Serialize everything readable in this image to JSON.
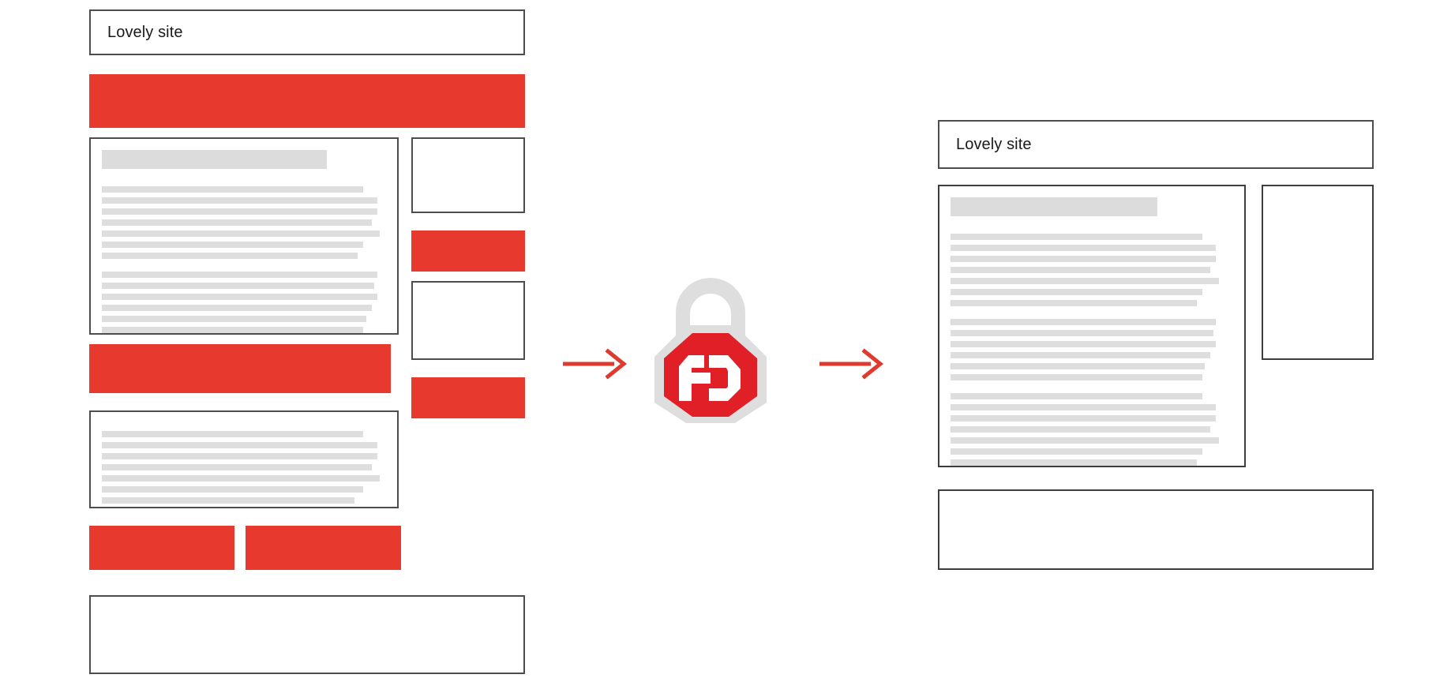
{
  "illustration": {
    "type": "adblock-before-after",
    "colors": {
      "ad_red": "#e8392e",
      "arrow_red": "#e0392e",
      "logo_red": "#e01f26",
      "logo_gray": "#dedede",
      "border_gray": "#4d4d4d",
      "skeleton_gray": "#dedede",
      "heading_gray": "#dcdcdc",
      "page_background": "#ffffff"
    }
  },
  "before_page": {
    "label": "page-with-ads",
    "title_bar": {
      "text": "Lovely site"
    },
    "top_banner_ad": {
      "label": "ad"
    },
    "article": {
      "heading_bar": true,
      "paragraphs": [
        {
          "line_widths": [
            93,
            98,
            98,
            96,
            99,
            93,
            91
          ]
        },
        {
          "line_widths": [
            98,
            97,
            98,
            96,
            94,
            93
          ]
        }
      ]
    },
    "sidebar": {
      "slots": [
        {
          "kind": "content-box"
        },
        {
          "kind": "ad"
        },
        {
          "kind": "content-box"
        },
        {
          "kind": "ad"
        }
      ]
    },
    "mid_banner_ad": {
      "label": "ad"
    },
    "second_article": {
      "heading_bar": false,
      "paragraphs": [
        {
          "line_widths": [
            93,
            98,
            98,
            96,
            99,
            93,
            90
          ]
        }
      ]
    },
    "bottom_ads": [
      {
        "label": "ad"
      },
      {
        "label": "ad"
      }
    ],
    "footer": {
      "kind": "content-box"
    }
  },
  "after_page": {
    "label": "page-without-ads",
    "title_bar": {
      "text": "Lovely site"
    },
    "article": {
      "heading_bar": true,
      "paragraphs": [
        {
          "line_widths": [
            90,
            95,
            95,
            93,
            96,
            90,
            88
          ]
        },
        {
          "line_widths": [
            95,
            94,
            95,
            93,
            91,
            90
          ]
        },
        {
          "line_widths": [
            90,
            95,
            95,
            93,
            96,
            90,
            88
          ]
        }
      ]
    },
    "sidebar": {
      "slots": [
        {
          "kind": "content-box"
        }
      ]
    },
    "footer": {
      "kind": "content-box"
    }
  },
  "flow": {
    "arrows": [
      {
        "name": "arrow-before-to-logo",
        "direction": "right"
      },
      {
        "name": "arrow-logo-to-after",
        "direction": "right"
      }
    ],
    "logo": {
      "name": "adblock-logo",
      "letters": "AD",
      "shape": "padlock-octagon"
    }
  }
}
